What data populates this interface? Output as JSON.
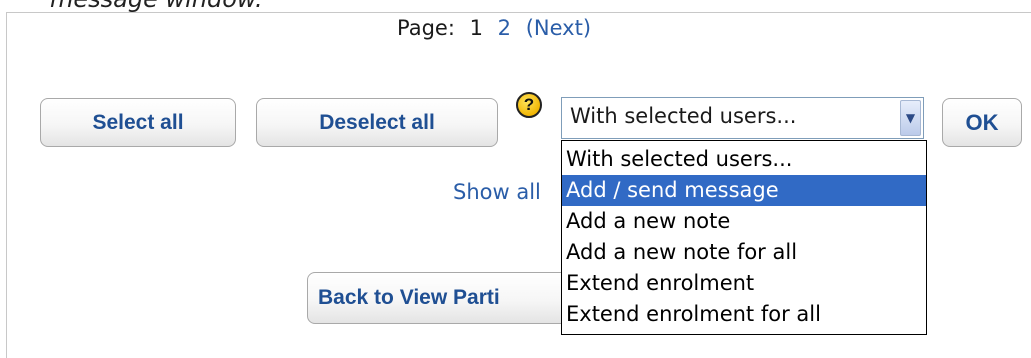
{
  "caption": "message window.",
  "pager": {
    "label": "Page:",
    "pages": [
      "1",
      "2"
    ],
    "next": "(Next)"
  },
  "buttons": {
    "select_all": "Select all",
    "deselect_all": "Deselect all",
    "ok": "OK",
    "back": "Back to View Parti"
  },
  "help_icon": "?",
  "action_select": {
    "value": "With selected users...",
    "options": [
      "With selected users...",
      "Add / send message",
      "Add a new note",
      "Add a new note for all",
      "Extend enrolment",
      "Extend enrolment for all"
    ],
    "highlighted_index": 1
  },
  "show_all": "Show all",
  "colors": {
    "link": "#2a5da8",
    "button_text": "#1f4f93",
    "highlight": "#316ac5"
  }
}
